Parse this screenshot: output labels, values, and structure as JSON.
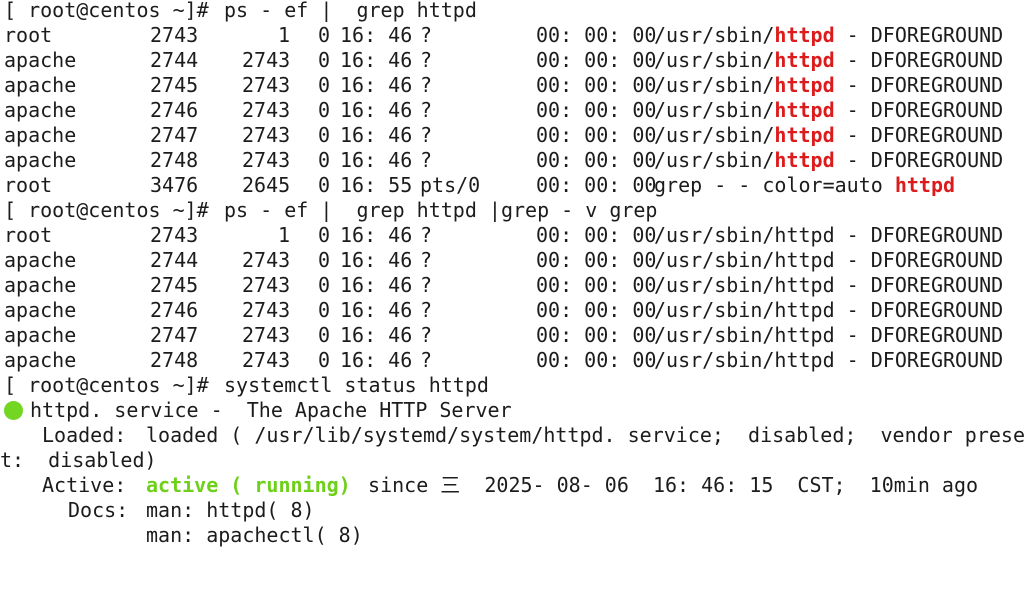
{
  "prompt": "[ root@centos ~]# ",
  "cmd1": "ps - ef |  grep httpd",
  "cmd2": "ps - ef |  grep httpd |grep - v grep",
  "cmd3": "systemctl status httpd",
  "ps1": [
    {
      "user": "root",
      "pid": "2743",
      "ppid": "1",
      "c": "0",
      "stime": "16: 46",
      "tty": "?",
      "time": "00: 00: 00",
      "path": "/usr/sbin/",
      "prog": "httpd",
      "args": " - DFOREGROUND"
    },
    {
      "user": "apache",
      "pid": "2744",
      "ppid": "2743",
      "c": "0",
      "stime": "16: 46",
      "tty": "?",
      "time": "00: 00: 00",
      "path": "/usr/sbin/",
      "prog": "httpd",
      "args": " - DFOREGROUND"
    },
    {
      "user": "apache",
      "pid": "2745",
      "ppid": "2743",
      "c": "0",
      "stime": "16: 46",
      "tty": "?",
      "time": "00: 00: 00",
      "path": "/usr/sbin/",
      "prog": "httpd",
      "args": " - DFOREGROUND"
    },
    {
      "user": "apache",
      "pid": "2746",
      "ppid": "2743",
      "c": "0",
      "stime": "16: 46",
      "tty": "?",
      "time": "00: 00: 00",
      "path": "/usr/sbin/",
      "prog": "httpd",
      "args": " - DFOREGROUND"
    },
    {
      "user": "apache",
      "pid": "2747",
      "ppid": "2743",
      "c": "0",
      "stime": "16: 46",
      "tty": "?",
      "time": "00: 00: 00",
      "path": "/usr/sbin/",
      "prog": "httpd",
      "args": " - DFOREGROUND"
    },
    {
      "user": "apache",
      "pid": "2748",
      "ppid": "2743",
      "c": "0",
      "stime": "16: 46",
      "tty": "?",
      "time": "00: 00: 00",
      "path": "/usr/sbin/",
      "prog": "httpd",
      "args": " - DFOREGROUND"
    },
    {
      "user": "root",
      "pid": "3476",
      "ppid": "2645",
      "c": "0",
      "stime": "16: 55",
      "tty": "pts/0",
      "time": "00: 00: 00",
      "path": "grep - - color=auto ",
      "prog": "httpd",
      "args": ""
    }
  ],
  "ps2": [
    {
      "user": "root",
      "pid": "2743",
      "ppid": "1",
      "c": "0",
      "stime": "16: 46",
      "tty": "?",
      "time": "00: 00: 00",
      "cmd": "/usr/sbin/httpd - DFOREGROUND"
    },
    {
      "user": "apache",
      "pid": "2744",
      "ppid": "2743",
      "c": "0",
      "stime": "16: 46",
      "tty": "?",
      "time": "00: 00: 00",
      "cmd": "/usr/sbin/httpd - DFOREGROUND"
    },
    {
      "user": "apache",
      "pid": "2745",
      "ppid": "2743",
      "c": "0",
      "stime": "16: 46",
      "tty": "?",
      "time": "00: 00: 00",
      "cmd": "/usr/sbin/httpd - DFOREGROUND"
    },
    {
      "user": "apache",
      "pid": "2746",
      "ppid": "2743",
      "c": "0",
      "stime": "16: 46",
      "tty": "?",
      "time": "00: 00: 00",
      "cmd": "/usr/sbin/httpd - DFOREGROUND"
    },
    {
      "user": "apache",
      "pid": "2747",
      "ppid": "2743",
      "c": "0",
      "stime": "16: 46",
      "tty": "?",
      "time": "00: 00: 00",
      "cmd": "/usr/sbin/httpd - DFOREGROUND"
    },
    {
      "user": "apache",
      "pid": "2748",
      "ppid": "2743",
      "c": "0",
      "stime": "16: 46",
      "tty": "?",
      "time": "00: 00: 00",
      "cmd": "/usr/sbin/httpd - DFOREGROUND"
    }
  ],
  "status": {
    "unit": "httpd. service -  The Apache HTTP Server",
    "loaded_label": "Loaded:",
    "loaded_value": "loaded ( /usr/lib/systemd/system/httpd. service;  disabled;  vendor prese",
    "loaded_wrap": "t:  disabled)",
    "active_label": "Active:",
    "active_state": "active ( running)",
    "active_rest": " since 三  2025- 08- 06  16: 46: 15  CST;  10min ago",
    "docs_label": "Docs:",
    "docs": [
      "man: httpd( 8)",
      "man: apachectl( 8)"
    ]
  },
  "colors": {
    "highlight": "#dc1c1c",
    "active": "#6fd01a",
    "status_dot": "#72d622"
  }
}
